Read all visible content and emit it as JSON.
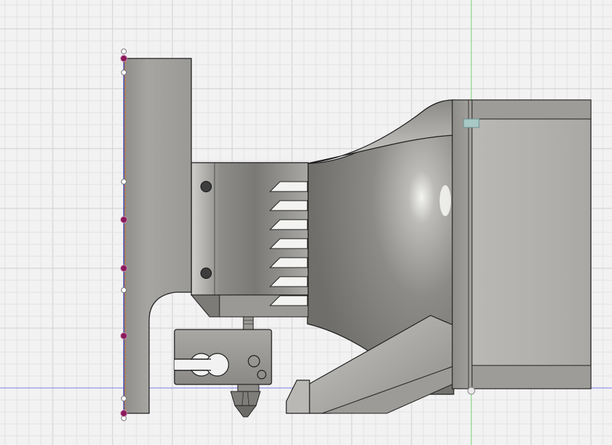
{
  "app": {
    "view_name": "",
    "description": ""
  },
  "colors": {
    "background": "#f2f2f2",
    "grid_minor": "#e3e3e3",
    "grid_major": "#cfcfcf",
    "axis_x": "#7c7cf0",
    "axis_y": "#6fd36f",
    "sketch_line": "#3a3ad0",
    "sketch_line_dashed": "#d7742a",
    "constraint_point": "#8a1a5a",
    "open_point": "#ffffff",
    "metal_light": "#c9c8c4",
    "metal_mid": "#9d9c98",
    "metal_dark": "#5e5d5a",
    "outline": "#1d1d1d"
  },
  "scene": {
    "parts": [
      {
        "id": "mount-plate",
        "kind": "bracket"
      },
      {
        "id": "heatsink",
        "kind": "finned-block",
        "fin_count": 7
      },
      {
        "id": "heater-block",
        "kind": "block"
      },
      {
        "id": "nozzle",
        "kind": "nozzle"
      },
      {
        "id": "fan-duct",
        "kind": "shroud"
      },
      {
        "id": "fan",
        "kind": "box-fan"
      }
    ],
    "sketch_points": {
      "filled": 5,
      "open": 6
    }
  }
}
